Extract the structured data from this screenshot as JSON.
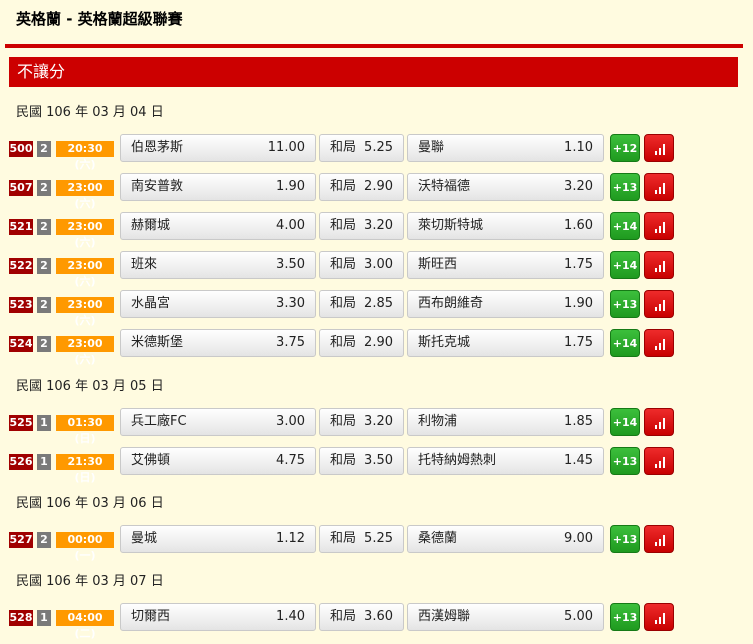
{
  "header": {
    "title": "英格蘭 - 英格蘭超級聯賽"
  },
  "section": {
    "label": "不讓分"
  },
  "draw_label": "和局",
  "colors": {
    "accent": "#cc0000",
    "time_badge": "#ff9900",
    "plus_button": "#2aa52a",
    "stats_button": "#dd0000"
  },
  "dates": [
    {
      "label": "民國 106 年 03 月 04 日"
    },
    {
      "label": "民國 106 年 03 月 05 日"
    },
    {
      "label": "民國 106 年 03 月 06 日"
    },
    {
      "label": "民國 106 年 03 月 07 日"
    }
  ],
  "matches": [
    {
      "no": "500",
      "group": "2",
      "time": "20:30 (六)",
      "home": "伯恩茅斯",
      "home_odds": "11.00",
      "draw_odds": "5.25",
      "away": "曼聯",
      "away_odds": "1.10",
      "more": "+12",
      "stats_icon": "bar-chart-icon"
    },
    {
      "no": "507",
      "group": "2",
      "time": "23:00 (六)",
      "home": "南安普敦",
      "home_odds": "1.90",
      "draw_odds": "2.90",
      "away": "沃特福德",
      "away_odds": "3.20",
      "more": "+13",
      "stats_icon": "bar-chart-icon"
    },
    {
      "no": "521",
      "group": "2",
      "time": "23:00 (六)",
      "home": "赫爾城",
      "home_odds": "4.00",
      "draw_odds": "3.20",
      "away": "萊切斯特城",
      "away_odds": "1.60",
      "more": "+14",
      "stats_icon": "bar-chart-icon"
    },
    {
      "no": "522",
      "group": "2",
      "time": "23:00 (六)",
      "home": "班來",
      "home_odds": "3.50",
      "draw_odds": "3.00",
      "away": "斯旺西",
      "away_odds": "1.75",
      "more": "+14",
      "stats_icon": "bar-chart-icon"
    },
    {
      "no": "523",
      "group": "2",
      "time": "23:00 (六)",
      "home": "水晶宮",
      "home_odds": "3.30",
      "draw_odds": "2.85",
      "away": "西布朗維奇",
      "away_odds": "1.90",
      "more": "+13",
      "stats_icon": "bar-chart-icon"
    },
    {
      "no": "524",
      "group": "2",
      "time": "23:00 (六)",
      "home": "米德斯堡",
      "home_odds": "3.75",
      "draw_odds": "2.90",
      "away": "斯托克城",
      "away_odds": "1.75",
      "more": "+14",
      "stats_icon": "bar-chart-icon"
    },
    {
      "no": "525",
      "group": "1",
      "time": "01:30 (日)",
      "home": "兵工廠FC",
      "home_odds": "3.00",
      "draw_odds": "3.20",
      "away": "利物浦",
      "away_odds": "1.85",
      "more": "+14",
      "stats_icon": "bar-chart-icon"
    },
    {
      "no": "526",
      "group": "1",
      "time": "21:30 (日)",
      "home": "艾佛頓",
      "home_odds": "4.75",
      "draw_odds": "3.50",
      "away": "托特納姆熱刺",
      "away_odds": "1.45",
      "more": "+13",
      "stats_icon": "bar-chart-icon"
    },
    {
      "no": "527",
      "group": "2",
      "time": "00:00 (一)",
      "home": "曼城",
      "home_odds": "1.12",
      "draw_odds": "5.25",
      "away": "桑德蘭",
      "away_odds": "9.00",
      "more": "+13",
      "stats_icon": "bar-chart-icon"
    },
    {
      "no": "528",
      "group": "1",
      "time": "04:00 (二)",
      "home": "切爾西",
      "home_odds": "1.40",
      "draw_odds": "3.60",
      "away": "西漢姆聯",
      "away_odds": "5.00",
      "more": "+13",
      "stats_icon": "bar-chart-icon"
    }
  ]
}
